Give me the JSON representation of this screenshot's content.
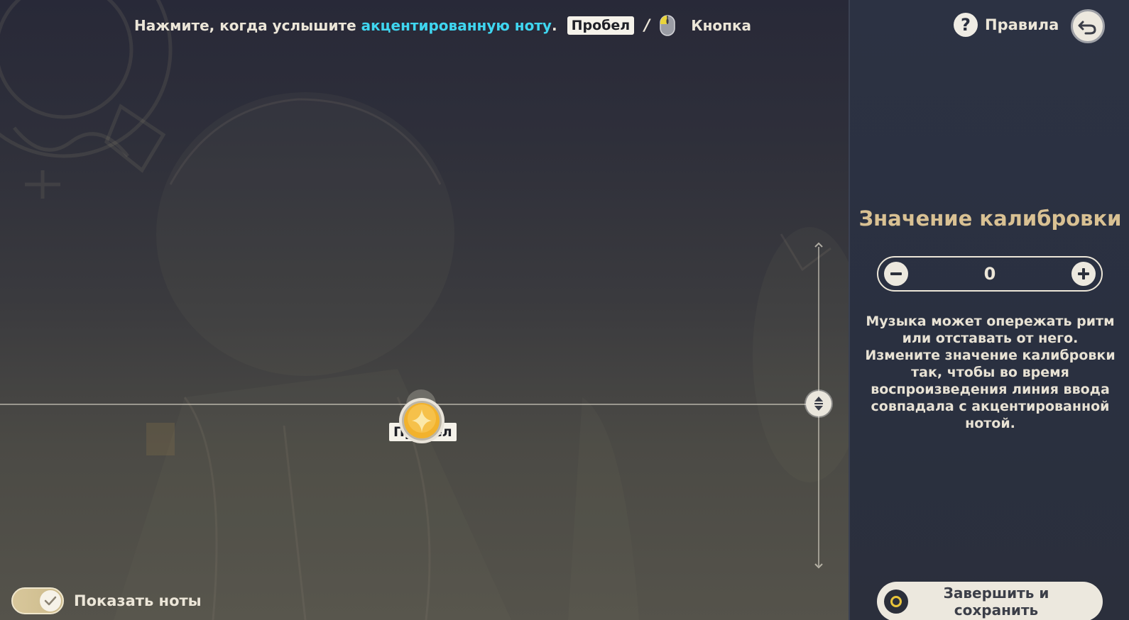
{
  "instruction": {
    "prefix": "Нажмите, когда услышите",
    "highlight": "акцентированную ноту",
    "suffix": ".",
    "key_label": "Пробел",
    "separator": "/",
    "mouse_icon": "mouse-left-click-icon",
    "mouse_label": "Кнопка"
  },
  "note": {
    "key_label": "Пробел",
    "icon": "star-note-icon"
  },
  "toggle": {
    "label": "Показать ноты",
    "checked": true
  },
  "panel": {
    "rules_label": "Правила",
    "title": "Значение калибровки",
    "calibration_value": "0",
    "description": "Музыка может опережать ритм или отставать от него. Измените значение калибровки так, чтобы во время воспроизведения линия ввода совпадала с акцентированной нотой.",
    "finish_label": "Завершить и сохранить"
  },
  "colors": {
    "accent": "#3fd6f0",
    "title_gold": "#d9c193",
    "note_gold": "#f2b22c",
    "button_light": "#ece8de",
    "panel_bg": "#2c3243"
  }
}
